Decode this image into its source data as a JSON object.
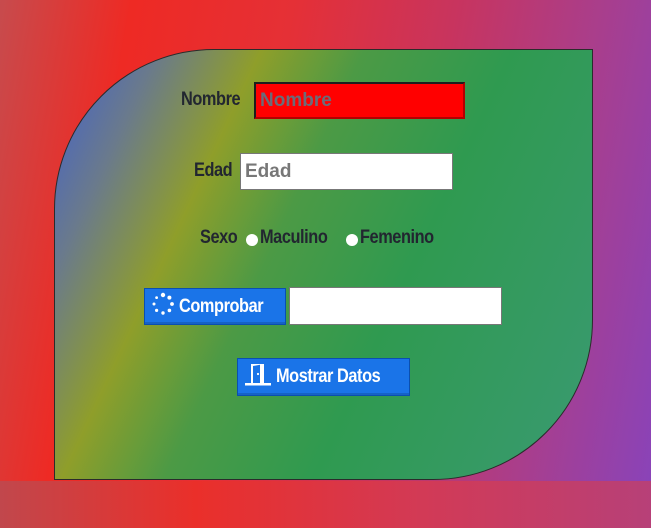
{
  "form": {
    "nombre": {
      "label": "Nombre",
      "placeholder": "Nombre",
      "value": ""
    },
    "edad": {
      "label": "Edad",
      "placeholder": "Edad",
      "value": ""
    },
    "sexo": {
      "label": "Sexo",
      "options": [
        "Maculino",
        "Femenino"
      ]
    },
    "comprobar": {
      "button_label": "Comprobar",
      "icon": "spinner-icon",
      "result_value": ""
    },
    "mostrar": {
      "button_label": "Mostrar Datos",
      "icon": "door-icon"
    }
  },
  "colors": {
    "button": "#1a74e8",
    "nombre_field": "#ff0000",
    "label_text": "#222630"
  }
}
